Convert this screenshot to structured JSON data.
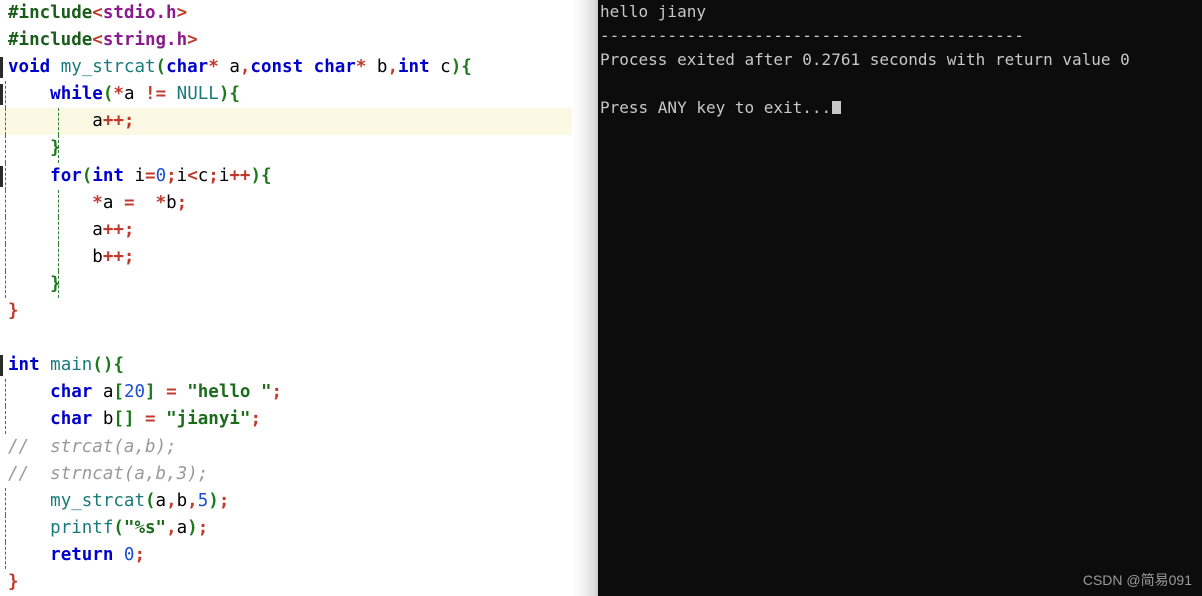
{
  "editor": {
    "name": "code-editor-pane",
    "highlighted_line_index": 4,
    "lines": [
      {
        "indent": 0,
        "fold": false,
        "guides": [],
        "text": "#include<stdio.h>"
      },
      {
        "indent": 0,
        "fold": false,
        "guides": [],
        "text": "#include<string.h>"
      },
      {
        "indent": 0,
        "fold": true,
        "guides": [],
        "text": "void my_strcat(char* a,const char* b,int c){"
      },
      {
        "indent": 1,
        "fold": true,
        "guides": [
          "g1"
        ],
        "text": "    while(*a != NULL){"
      },
      {
        "indent": 2,
        "fold": false,
        "guides": [
          "g1",
          "g2"
        ],
        "text": "        a++;"
      },
      {
        "indent": 1,
        "fold": false,
        "guides": [
          "g1",
          "g2"
        ],
        "text": "    }"
      },
      {
        "indent": 1,
        "fold": true,
        "guides": [
          "g1"
        ],
        "text": "    for(int i=0;i<c;i++){"
      },
      {
        "indent": 2,
        "fold": false,
        "guides": [
          "g1",
          "g2"
        ],
        "text": "        *a =  *b;"
      },
      {
        "indent": 2,
        "fold": false,
        "guides": [
          "g1",
          "g2"
        ],
        "text": "        a++;"
      },
      {
        "indent": 2,
        "fold": false,
        "guides": [
          "g1",
          "g2"
        ],
        "text": "        b++;"
      },
      {
        "indent": 1,
        "fold": false,
        "guides": [
          "g1",
          "g2"
        ],
        "text": "    }"
      },
      {
        "indent": 0,
        "fold": false,
        "guides": [],
        "text": "}"
      },
      {
        "indent": 0,
        "fold": false,
        "guides": [],
        "text": ""
      },
      {
        "indent": 0,
        "fold": true,
        "guides": [],
        "text": "int main(){"
      },
      {
        "indent": 1,
        "fold": false,
        "guides": [
          "g1"
        ],
        "text": "    char a[20] = \"hello \";"
      },
      {
        "indent": 1,
        "fold": false,
        "guides": [
          "g1"
        ],
        "text": "    char b[] = \"jianyi\";"
      },
      {
        "indent": 0,
        "fold": false,
        "guides": [],
        "text": "//  strcat(a,b);"
      },
      {
        "indent": 0,
        "fold": false,
        "guides": [],
        "text": "//  strncat(a,b,3);"
      },
      {
        "indent": 1,
        "fold": false,
        "guides": [
          "g1"
        ],
        "text": "    my_strcat(a,b,5);"
      },
      {
        "indent": 1,
        "fold": false,
        "guides": [
          "g1"
        ],
        "text": "    printf(\"%s\",a);"
      },
      {
        "indent": 1,
        "fold": false,
        "guides": [
          "g1"
        ],
        "text": "    return 0;"
      },
      {
        "indent": 0,
        "fold": false,
        "guides": [],
        "text": "}"
      }
    ]
  },
  "console": {
    "name": "program-output-console",
    "lines": [
      "hello jiany",
      "--------------------------------------------",
      "Process exited after 0.2761 seconds with return value 0",
      "",
      "Press ANY key to exit..."
    ],
    "program_output": "hello jiany",
    "separator": "--------------------------------------------",
    "exit_message": "Process exited after 0.2761 seconds with return value 0",
    "exit_seconds": "0.2761",
    "return_value": "0",
    "prompt": "Press ANY key to exit...",
    "cursor_visible": true
  },
  "watermark": {
    "text": "CSDN @简易091"
  },
  "colors": {
    "editor_background": "#ffffff",
    "console_background": "#0c0c0c",
    "console_text": "#c8c8c8",
    "highlight_line": "#fbf8e3",
    "keyword": "#0000cd",
    "function": "#1a7a7a",
    "string": "#1a6b1a",
    "number": "#1a4fd1",
    "comment": "#999999",
    "operator": "#c0392b",
    "bracket": "#1a7a1a",
    "preprocessor": "#1a5c1a",
    "header_name": "#8b1a8b",
    "guide_level1": "#c0392b",
    "guide_level2": "#2e7d32"
  }
}
